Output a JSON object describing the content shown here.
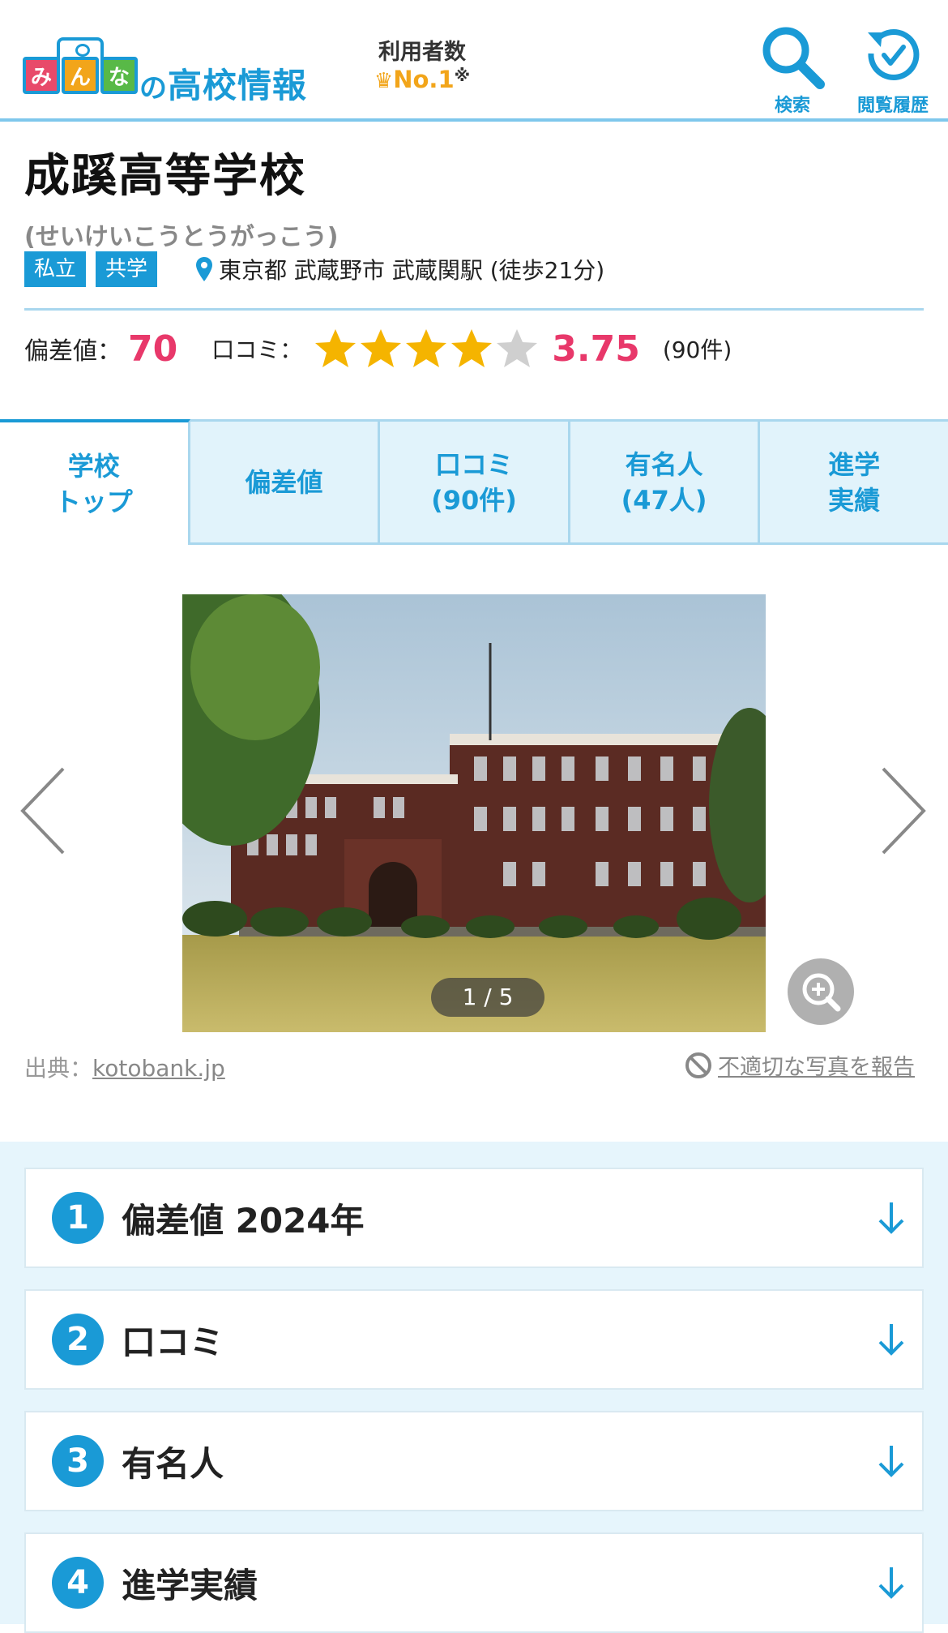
{
  "header": {
    "logo": {
      "tiles": [
        "み",
        "ん",
        "な"
      ],
      "no": "の",
      "text": "高校情報"
    },
    "rank": {
      "line1": "利用者数",
      "crown_icon": "crown-icon",
      "line2": "No.1",
      "mark": "※"
    },
    "search_label": "検索",
    "history_label": "閲覧履歴"
  },
  "school": {
    "name": "成蹊高等学校",
    "kana": "(せいけいこうとうがっこう)",
    "tags": [
      "私立",
      "共学"
    ],
    "location": "東京都 武蔵野市 武蔵関駅 (徒歩21分)",
    "deviation_label": "偏差値：",
    "deviation": "70",
    "review_label": "口コミ：",
    "rating": 3.75,
    "rating_text": "3.75",
    "review_count": "(90件)"
  },
  "tabs": [
    {
      "label": "学校\nトップ",
      "active": true
    },
    {
      "label": "偏差値",
      "active": false
    },
    {
      "label": "口コミ\n(90件)",
      "active": false
    },
    {
      "label": "有名人\n(47人)",
      "active": false
    },
    {
      "label": "進学\n実績",
      "active": false
    }
  ],
  "gallery": {
    "counter": "1 / 5",
    "credit_prefix": "出典：",
    "credit_link": "kotobank.jp",
    "report": "不適切な写真を報告"
  },
  "sections": [
    {
      "num": "1",
      "title": "偏差値 2024年"
    },
    {
      "num": "2",
      "title": "口コミ"
    },
    {
      "num": "3",
      "title": "有名人"
    },
    {
      "num": "4",
      "title": "進学実績"
    }
  ],
  "colors": {
    "accent": "#1a9ad6",
    "highlight": "#e8386a",
    "star": "#f5b400",
    "star_empty": "#cfcfcf"
  }
}
